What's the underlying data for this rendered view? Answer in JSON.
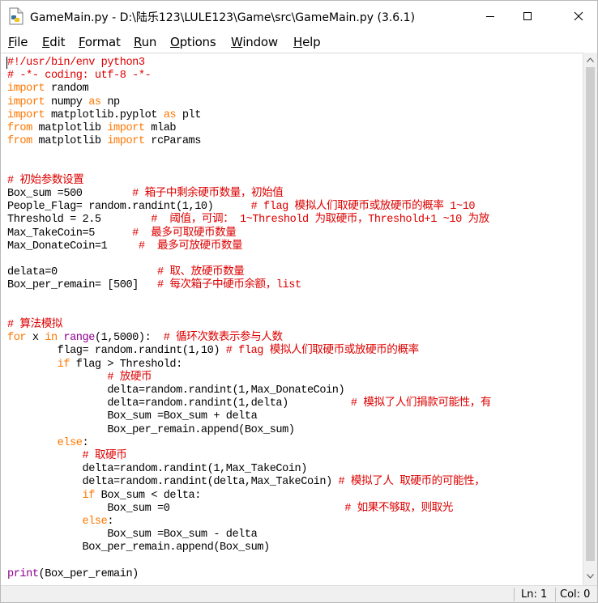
{
  "window": {
    "title": "GameMain.py - D:\\陆乐123\\LULE123\\Game\\src\\GameMain.py (3.6.1)"
  },
  "menu": [
    {
      "label": "File"
    },
    {
      "label": "Edit"
    },
    {
      "label": "Format"
    },
    {
      "label": "Run"
    },
    {
      "label": "Options"
    },
    {
      "label": "Window"
    },
    {
      "label": "Help"
    }
  ],
  "status": {
    "line": "Ln: 1",
    "col": "Col: 0"
  },
  "colors": {
    "keyword": "#ff7700",
    "builtin": "#900090",
    "comment": "#dd0000",
    "string": "#00aa00"
  },
  "code": [
    [
      [
        "cm",
        "#!/usr/bin/env python3"
      ]
    ],
    [
      [
        "cm",
        "# -*- coding: utf-8 -*-"
      ]
    ],
    [
      [
        "kw",
        "import"
      ],
      [
        "n",
        " random"
      ]
    ],
    [
      [
        "kw",
        "import"
      ],
      [
        "n",
        " numpy "
      ],
      [
        "kw",
        "as"
      ],
      [
        "n",
        " np"
      ]
    ],
    [
      [
        "kw",
        "import"
      ],
      [
        "n",
        " matplotlib.pyplot "
      ],
      [
        "kw",
        "as"
      ],
      [
        "n",
        " plt"
      ]
    ],
    [
      [
        "kw",
        "from"
      ],
      [
        "n",
        " matplotlib "
      ],
      [
        "kw",
        "import"
      ],
      [
        "n",
        " mlab"
      ]
    ],
    [
      [
        "kw",
        "from"
      ],
      [
        "n",
        " matplotlib "
      ],
      [
        "kw",
        "import"
      ],
      [
        "n",
        " rcParams"
      ]
    ],
    [],
    [],
    [
      [
        "cm",
        "# 初始参数设置"
      ]
    ],
    [
      [
        "n",
        "Box_sum =500        "
      ],
      [
        "cm",
        "# 箱子中剩余硬币数量，初始值"
      ]
    ],
    [
      [
        "n",
        "People_Flag= random.randint(1,10)      "
      ],
      [
        "cm",
        "# flag 模拟人们取硬币或放硬币的概率 1~10"
      ]
    ],
    [
      [
        "n",
        "Threshold = 2.5        "
      ],
      [
        "cm",
        "#  阈值，可调： 1~Threshold 为取硬币，Threshold+1 ~10 为放"
      ]
    ],
    [
      [
        "n",
        "Max_TakeCoin=5      "
      ],
      [
        "cm",
        "#  最多可取硬币数量"
      ]
    ],
    [
      [
        "n",
        "Max_DonateCoin=1     "
      ],
      [
        "cm",
        "#  最多可放硬币数量"
      ]
    ],
    [],
    [
      [
        "n",
        "delata=0                "
      ],
      [
        "cm",
        "# 取、放硬币数量"
      ]
    ],
    [
      [
        "n",
        "Box_per_remain= [500]   "
      ],
      [
        "cm",
        "# 每次箱子中硬币余额，list"
      ]
    ],
    [],
    [],
    [
      [
        "cm",
        "# 算法模拟"
      ]
    ],
    [
      [
        "kw",
        "for"
      ],
      [
        "n",
        " x "
      ],
      [
        "kw",
        "in"
      ],
      [
        "n",
        " "
      ],
      [
        "bi",
        "range"
      ],
      [
        "n",
        "(1,5000):  "
      ],
      [
        "cm",
        "# 循环次数表示参与人数"
      ]
    ],
    [
      [
        "n",
        "        flag= random.randint(1,10) "
      ],
      [
        "cm",
        "# flag 模拟人们取硬币或放硬币的概率"
      ]
    ],
    [
      [
        "n",
        "        "
      ],
      [
        "kw",
        "if"
      ],
      [
        "n",
        " flag > Threshold:"
      ]
    ],
    [
      [
        "n",
        "                "
      ],
      [
        "cm",
        "# 放硬币"
      ]
    ],
    [
      [
        "n",
        "                delta=random.randint(1,Max_DonateCoin)"
      ]
    ],
    [
      [
        "n",
        "                delta=random.randint(1,delta)          "
      ],
      [
        "cm",
        "# 模拟了人们捐款可能性，有"
      ]
    ],
    [
      [
        "n",
        "                Box_sum =Box_sum + delta"
      ]
    ],
    [
      [
        "n",
        "                Box_per_remain.append(Box_sum)"
      ]
    ],
    [
      [
        "n",
        "        "
      ],
      [
        "kw",
        "else"
      ],
      [
        "n",
        ":"
      ]
    ],
    [
      [
        "n",
        "            "
      ],
      [
        "cm",
        "# 取硬币"
      ]
    ],
    [
      [
        "n",
        "            delta=random.randint(1,Max_TakeCoin)"
      ]
    ],
    [
      [
        "n",
        "            delta=random.randint(delta,Max_TakeCoin) "
      ],
      [
        "cm",
        "# 模拟了人 取硬币的可能性，"
      ]
    ],
    [
      [
        "n",
        "            "
      ],
      [
        "kw",
        "if"
      ],
      [
        "n",
        " Box_sum < delta:"
      ]
    ],
    [
      [
        "n",
        "                Box_sum =0                            "
      ],
      [
        "cm",
        "# 如果不够取，则取光"
      ]
    ],
    [
      [
        "n",
        "            "
      ],
      [
        "kw",
        "else"
      ],
      [
        "n",
        ":"
      ]
    ],
    [
      [
        "n",
        "                Box_sum =Box_sum - delta"
      ]
    ],
    [
      [
        "n",
        "            Box_per_remain.append(Box_sum)"
      ]
    ],
    [],
    [
      [
        "bi",
        "print"
      ],
      [
        "n",
        "(Box_per_remain)"
      ]
    ]
  ]
}
